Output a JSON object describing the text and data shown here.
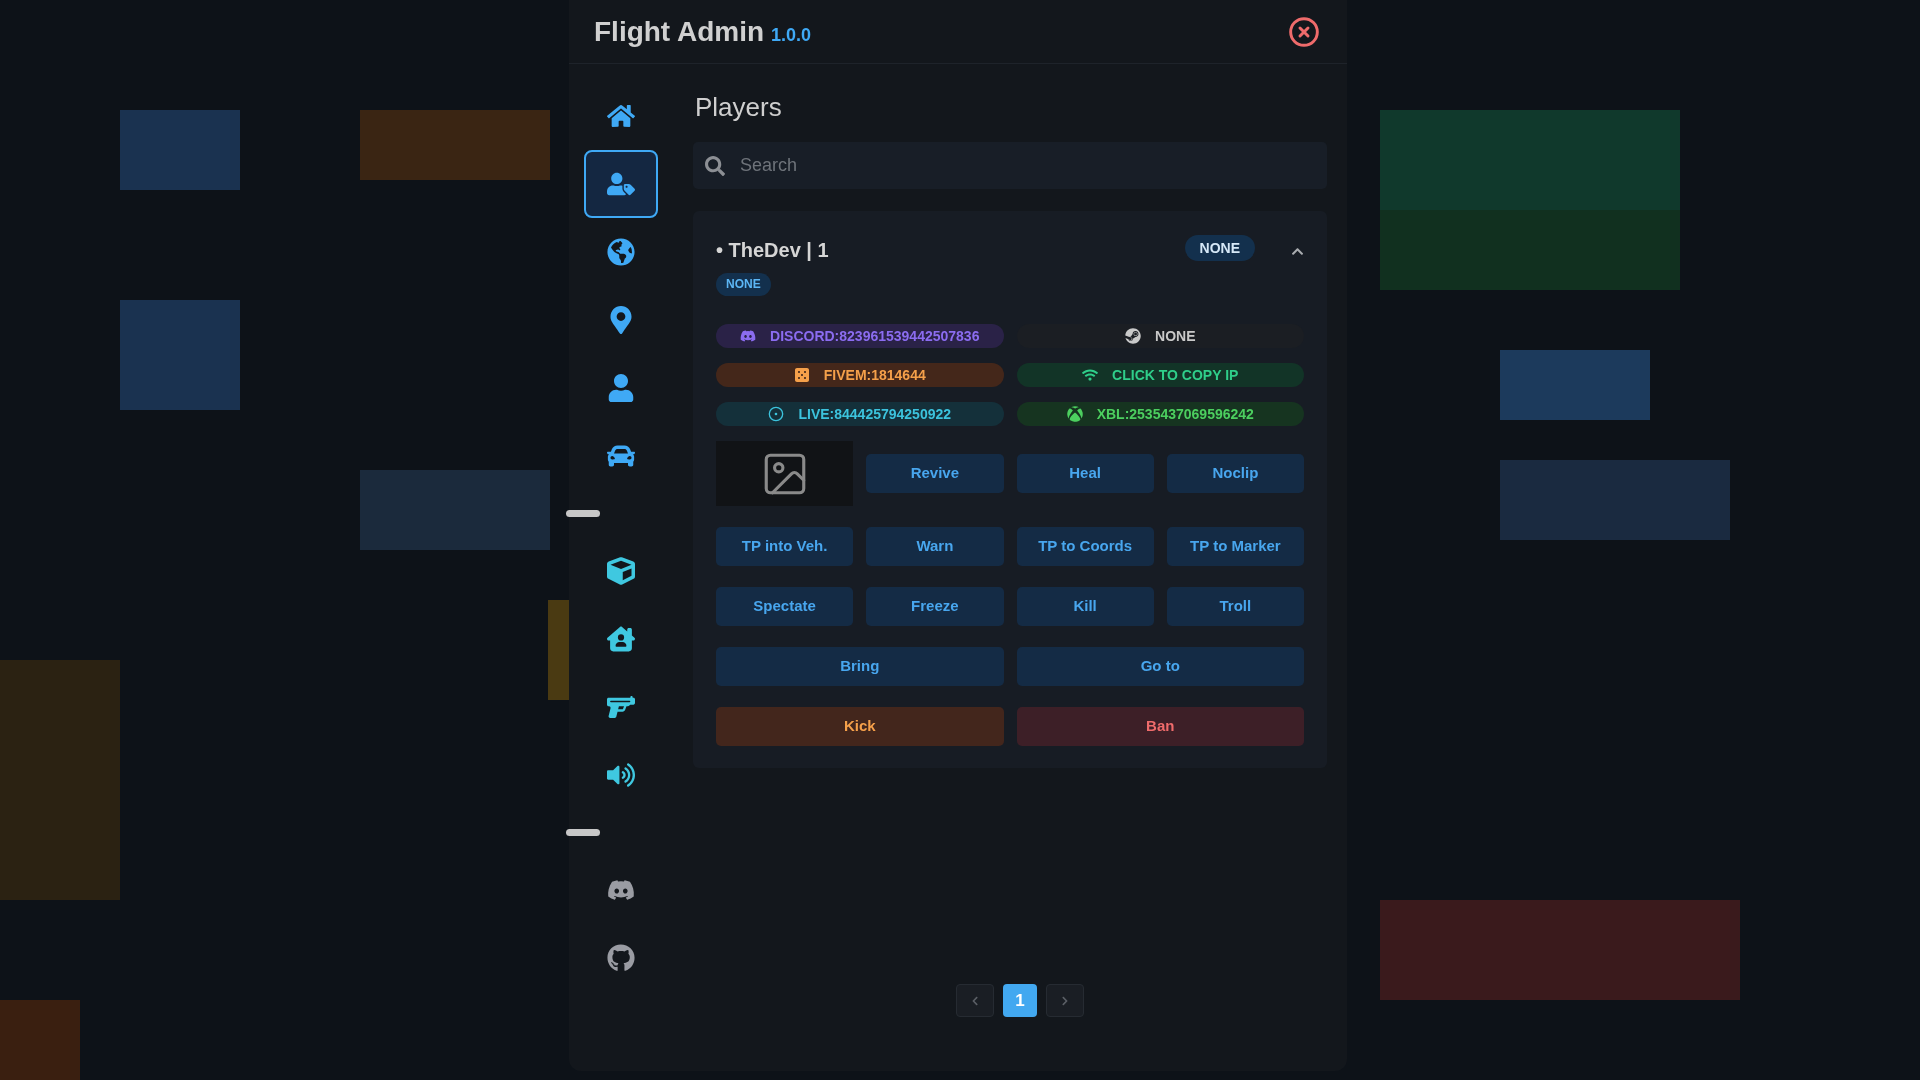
{
  "window": {
    "title": "Flight Admin",
    "version": "1.0.0"
  },
  "sidebar": {
    "items": [
      {
        "kind": "home",
        "selected": false,
        "color": "#3fa9f5"
      },
      {
        "kind": "players",
        "selected": true,
        "color": "#3fa9f5"
      },
      {
        "kind": "world",
        "selected": false,
        "color": "#3fa9f5"
      },
      {
        "kind": "location",
        "selected": false,
        "color": "#3fa9f5"
      },
      {
        "kind": "self",
        "selected": false,
        "color": "#3fa9f5"
      },
      {
        "kind": "vehicle",
        "selected": false,
        "color": "#3fa9f5"
      },
      {
        "kind": "divider"
      },
      {
        "kind": "objects",
        "selected": false,
        "color": "#3fc8e0"
      },
      {
        "kind": "housing",
        "selected": false,
        "color": "#3fc8e0"
      },
      {
        "kind": "weapons",
        "selected": false,
        "color": "#3fc8e0"
      },
      {
        "kind": "sound",
        "selected": false,
        "color": "#3fc8e0"
      },
      {
        "kind": "divider"
      },
      {
        "kind": "discord",
        "selected": false,
        "color": "#9a9ca3"
      },
      {
        "kind": "github",
        "selected": false,
        "color": "#9a9ca3"
      }
    ]
  },
  "page": {
    "title": "Players"
  },
  "search": {
    "placeholder": "Search"
  },
  "player": {
    "name": "• TheDev | 1",
    "group": "NONE",
    "role": "NONE",
    "expanded": true,
    "identifiers": [
      {
        "kind": "discord",
        "text": "DISCORD:823961539442507836"
      },
      {
        "kind": "steam",
        "text": "NONE"
      },
      {
        "kind": "fivem",
        "text": "FIVEM:1814644"
      },
      {
        "kind": "ip",
        "text": "CLICK TO COPY IP"
      },
      {
        "kind": "live",
        "text": "LIVE:844425794250922"
      },
      {
        "kind": "xbl",
        "text": "XBL:2535437069596242"
      }
    ],
    "actions": [
      {
        "kind": "normal",
        "label": "Revive"
      },
      {
        "kind": "normal",
        "label": "Heal"
      },
      {
        "kind": "normal",
        "label": "Noclip"
      },
      {
        "kind": "normal",
        "label": "TP into Veh."
      },
      {
        "kind": "normal",
        "label": "Warn"
      },
      {
        "kind": "normal",
        "label": "TP to Coords"
      },
      {
        "kind": "normal",
        "label": "TP to Marker"
      },
      {
        "kind": "normal",
        "label": "Spectate"
      },
      {
        "kind": "normal",
        "label": "Freeze"
      },
      {
        "kind": "normal",
        "label": "Kill"
      },
      {
        "kind": "normal",
        "label": "Troll"
      },
      {
        "kind": "wide",
        "label": "Bring"
      },
      {
        "kind": "wide",
        "label": "Go to"
      },
      {
        "kind": "warning",
        "label": "Kick"
      },
      {
        "kind": "danger",
        "label": "Ban"
      }
    ]
  },
  "pagination": {
    "pages": [
      {
        "label": "1",
        "selected": true
      }
    ]
  }
}
